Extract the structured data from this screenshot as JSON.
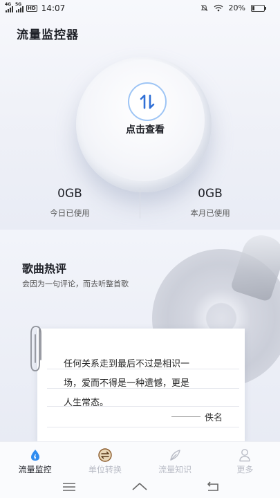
{
  "status_bar": {
    "network_1": "4G",
    "network_2": "5G",
    "hd": "HD",
    "time": "14:07",
    "battery": "20%",
    "battery_level": 0.2
  },
  "header": {
    "title": "流量监控器"
  },
  "dial": {
    "label": "点击查看",
    "icon": "swap-arrows-icon"
  },
  "stats": {
    "today": {
      "value": "0GB",
      "label": "今日已使用"
    },
    "month": {
      "value": "0GB",
      "label": "本月已使用"
    }
  },
  "music": {
    "title": "歌曲热评",
    "subtitle": "会因为一句评论，而去听整首歌",
    "quote_lines": [
      "任何关系走到最后不过是相识一",
      "场，爱而不得是一种遗憾，更是",
      "人生常态。"
    ],
    "author": "佚名"
  },
  "tabs": [
    {
      "label": "流量监控",
      "icon": "drop-icon",
      "active": true
    },
    {
      "label": "单位转换",
      "icon": "convert-icon",
      "active": false
    },
    {
      "label": "流量知识",
      "icon": "feather-icon",
      "active": false
    },
    {
      "label": "更多",
      "icon": "person-icon",
      "active": false
    }
  ],
  "colors": {
    "accent": "#2f8cf0",
    "text": "#1d1f26",
    "inactive": "#b9bcc6"
  }
}
